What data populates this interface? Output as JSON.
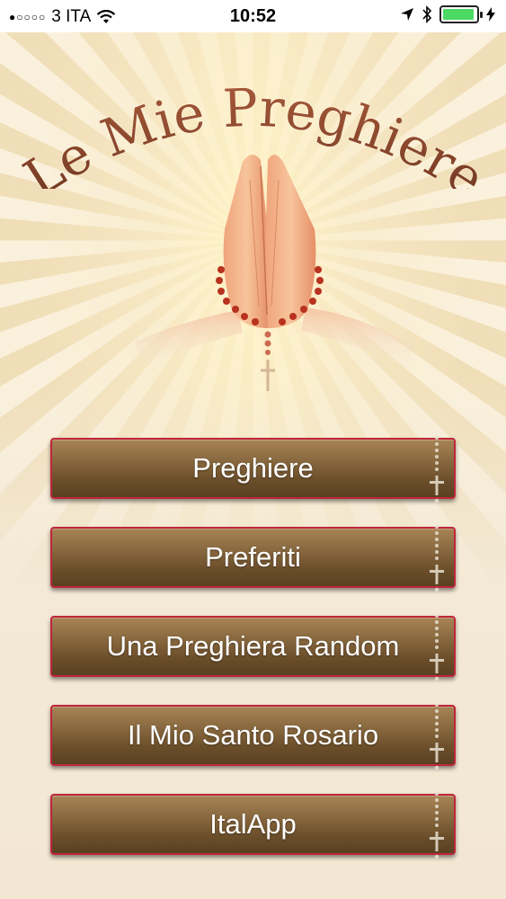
{
  "status_bar": {
    "signal_dots": "●○○○○",
    "carrier": "3 ITA",
    "wifi_icon": "wifi-icon",
    "time": "10:52",
    "location_icon": "location-arrow-icon",
    "bluetooth_icon": "bluetooth-icon",
    "battery_level": 0.95,
    "charging_icon": "charging-bolt-icon"
  },
  "app": {
    "title": "Le Mie Preghiere",
    "colors": {
      "title": "#8b4a2e",
      "button_border": "#c0263a",
      "button_fill": "#7a5a34",
      "button_text": "#ffffff"
    }
  },
  "menu": {
    "items": [
      {
        "label": "Preghiere"
      },
      {
        "label": "Preferiti"
      },
      {
        "label": "Una Preghiera Random"
      },
      {
        "label": "Il Mio Santo Rosario"
      },
      {
        "label": "ItalApp"
      }
    ]
  }
}
